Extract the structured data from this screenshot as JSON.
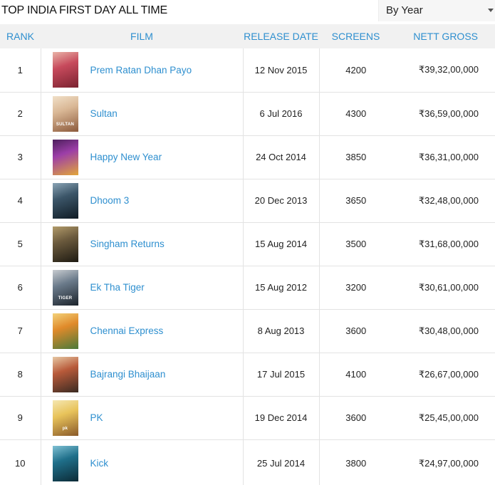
{
  "page": {
    "title": "TOP INDIA FIRST DAY ALL TIME",
    "filter": {
      "selected": "By Year"
    }
  },
  "table": {
    "headers": {
      "rank": "RANK",
      "film": "FILM",
      "release_date": "RELEASE DATE",
      "screens": "SCREENS",
      "nett_gross": "NETT GROSS"
    },
    "rows": [
      {
        "rank": "1",
        "film": "Prem Ratan Dhan Payo",
        "release_date": "12 Nov 2015",
        "screens": "4200",
        "nett_gross": "₹39,32,00,000",
        "poster": {
          "icon": "movie-poster-icon",
          "colors": [
            "#c74a5c",
            "#7a2230",
            "#e9b3a7"
          ]
        }
      },
      {
        "rank": "2",
        "film": "Sultan",
        "release_date": "6 Jul 2016",
        "screens": "4300",
        "nett_gross": "₹36,59,00,000",
        "poster": {
          "icon": "movie-poster-icon",
          "colors": [
            "#d9b795",
            "#8c5a3c",
            "#f1e0c8"
          ],
          "title": "SULTAN"
        }
      },
      {
        "rank": "3",
        "film": "Happy New Year",
        "release_date": "24 Oct 2014",
        "screens": "3850",
        "nett_gross": "₹36,31,00,000",
        "poster": {
          "icon": "movie-poster-icon",
          "colors": [
            "#9c3ea8",
            "#e2a63a",
            "#4c1f5c"
          ]
        }
      },
      {
        "rank": "4",
        "film": "Dhoom 3",
        "release_date": "20 Dec 2013",
        "screens": "3650",
        "nett_gross": "₹32,48,00,000",
        "poster": {
          "icon": "movie-poster-icon",
          "colors": [
            "#3b5568",
            "#0f1b24",
            "#8aa4b5"
          ]
        }
      },
      {
        "rank": "5",
        "film": "Singham Returns",
        "release_date": "15 Aug 2014",
        "screens": "3500",
        "nett_gross": "₹31,68,00,000",
        "poster": {
          "icon": "movie-poster-icon",
          "colors": [
            "#6b5a3d",
            "#1e1a12",
            "#b29b6a"
          ]
        }
      },
      {
        "rank": "6",
        "film": "Ek Tha Tiger",
        "release_date": "15 Aug 2012",
        "screens": "3200",
        "nett_gross": "₹30,61,00,000",
        "poster": {
          "icon": "movie-poster-icon",
          "colors": [
            "#6a7a8a",
            "#1c232b",
            "#c8ccd0"
          ],
          "title": "TIGER"
        }
      },
      {
        "rank": "7",
        "film": "Chennai Express",
        "release_date": "8 Aug 2013",
        "screens": "3600",
        "nett_gross": "₹30,48,00,000",
        "poster": {
          "icon": "movie-poster-icon",
          "colors": [
            "#e08a2a",
            "#4a7a3a",
            "#f3d27a"
          ]
        }
      },
      {
        "rank": "8",
        "film": "Bajrangi Bhaijaan",
        "release_date": "17 Jul 2015",
        "screens": "4100",
        "nett_gross": "₹26,67,00,000",
        "poster": {
          "icon": "movie-poster-icon",
          "colors": [
            "#b85a3a",
            "#3a2a22",
            "#e7c8a4"
          ]
        }
      },
      {
        "rank": "9",
        "film": "PK",
        "release_date": "19 Dec 2014",
        "screens": "3600",
        "nett_gross": "₹25,45,00,000",
        "poster": {
          "icon": "movie-poster-icon",
          "colors": [
            "#e8c35a",
            "#8a5a2a",
            "#f5e7b2"
          ],
          "title": "pk"
        }
      },
      {
        "rank": "10",
        "film": "Kick",
        "release_date": "25 Jul 2014",
        "screens": "3800",
        "nett_gross": "₹24,97,00,000",
        "poster": {
          "icon": "movie-poster-icon",
          "colors": [
            "#1f6f8a",
            "#0c2a36",
            "#7fc1d4"
          ]
        }
      }
    ]
  },
  "colors": {
    "accent": "#2e8fcf",
    "header_bg": "#f1f1f1",
    "row_border": "#e3e3e3"
  }
}
